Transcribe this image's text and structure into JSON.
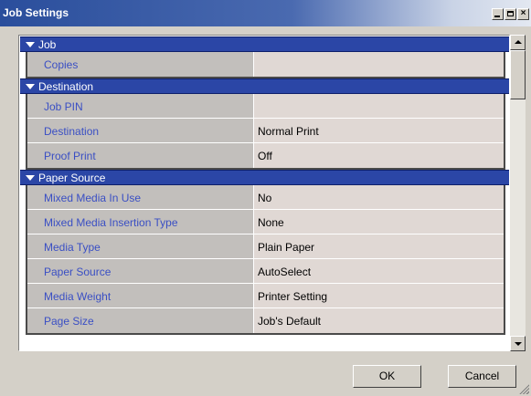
{
  "window": {
    "title": "Job Settings",
    "controls": {
      "minimize": "_",
      "maximize": "□",
      "close": "×"
    }
  },
  "sections": [
    {
      "header": "Job",
      "rows": [
        {
          "name": "Copies",
          "value": ""
        }
      ]
    },
    {
      "header": "Destination",
      "rows": [
        {
          "name": "Job PIN",
          "value": ""
        },
        {
          "name": "Destination",
          "value": "Normal Print"
        },
        {
          "name": "Proof Print",
          "value": "Off"
        }
      ]
    },
    {
      "header": "Paper Source",
      "rows": [
        {
          "name": "Mixed Media In Use",
          "value": "No"
        },
        {
          "name": "Mixed Media Insertion Type",
          "value": "None"
        },
        {
          "name": "Media Type",
          "value": "Plain Paper"
        },
        {
          "name": "Paper Source",
          "value": "AutoSelect"
        },
        {
          "name": "Media Weight",
          "value": "Printer Setting"
        },
        {
          "name": "Page Size",
          "value": "Job's Default"
        }
      ]
    }
  ],
  "buttons": {
    "ok": "OK",
    "cancel": "Cancel"
  },
  "colors": {
    "section_header": "#2b46a6",
    "property_name_text": "#3a4fc4",
    "name_cell_bg": "#c2bfbc",
    "value_cell_bg": "#e0d8d4"
  }
}
